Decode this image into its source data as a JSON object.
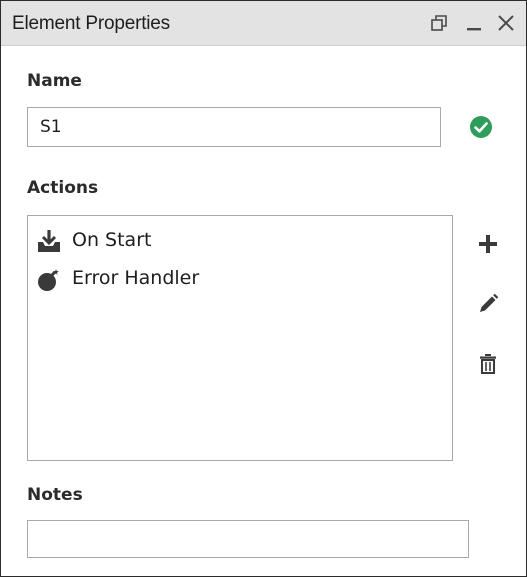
{
  "window": {
    "title": "Element Properties",
    "buttons": {
      "restore_icon": "restore-window-icon",
      "minimize_icon": "minimize-icon",
      "close_icon": "close-icon"
    }
  },
  "name_section": {
    "label": "Name",
    "value": "S1",
    "status_icon": "check-circle-icon",
    "status_color": "#2e9c5a"
  },
  "actions_section": {
    "label": "Actions",
    "items": [
      {
        "label": "On Start",
        "icon": "download-tray-icon"
      },
      {
        "label": "Error Handler",
        "icon": "bomb-icon"
      }
    ],
    "buttons": {
      "add_icon": "plus-icon",
      "edit_icon": "pencil-icon",
      "delete_icon": "trash-icon"
    }
  },
  "notes_section": {
    "label": "Notes",
    "value": ""
  },
  "colors": {
    "titlebar_bg": "#e3e3e3",
    "icon_dark": "#3a3a3a",
    "border": "#a9a9a9"
  }
}
